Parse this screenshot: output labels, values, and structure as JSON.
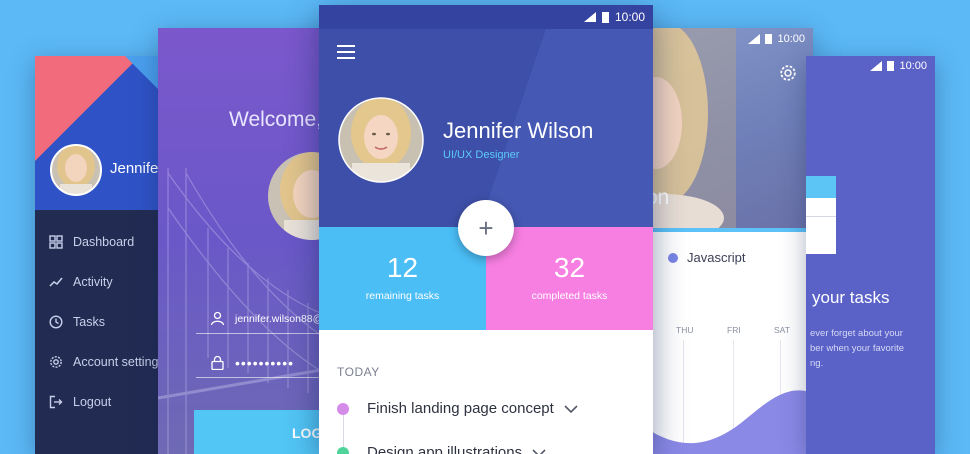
{
  "drawer": {
    "user_name": "Jennifer",
    "menu": [
      {
        "label": "Dashboard",
        "icon": "dashboard-icon"
      },
      {
        "label": "Activity",
        "icon": "trending-up-icon"
      },
      {
        "label": "Tasks",
        "icon": "clock-icon"
      },
      {
        "label": "Account settings",
        "icon": "gear-icon"
      },
      {
        "label": "Logout",
        "icon": "logout-icon"
      }
    ]
  },
  "login": {
    "welcome": "Welcome,",
    "email": "jennifer.wilson88@",
    "password_mask": "••••••••••",
    "login_label": "LOG"
  },
  "main": {
    "status_time": "10:00",
    "name": "Jennifer Wilson",
    "role": "UI/UX Designer",
    "remaining_count": "12",
    "remaining_label": "remaining tasks",
    "completed_count": "32",
    "completed_label": "completed tasks",
    "fab_label": "+",
    "section": "TODAY",
    "tasks": [
      {
        "label": "Finish landing page concept",
        "color": "#d58be8"
      },
      {
        "label": "Design app illustrations",
        "color": "#4fd39a"
      }
    ]
  },
  "profile": {
    "status_time": "10:00",
    "name_partial": "on",
    "legend": "Javascript",
    "days": [
      "THU",
      "FRI",
      "SAT"
    ]
  },
  "onboarding": {
    "status_time": "10:00",
    "title": "your tasks",
    "desc_lines": [
      "ever forget about your",
      "ber when your favorite",
      "ng."
    ]
  },
  "colors": {
    "background": "#5cb9f5",
    "primary": "#3d4fa8",
    "accent_blue": "#4bbef6",
    "accent_pink": "#f77fe2"
  }
}
